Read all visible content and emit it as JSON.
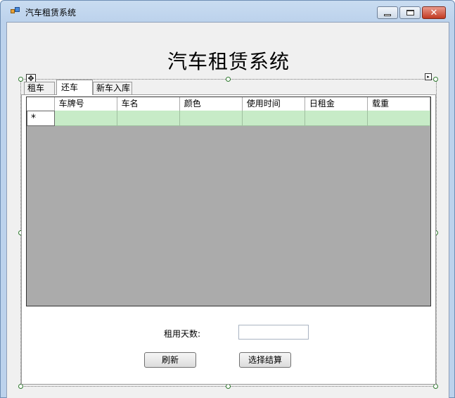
{
  "window": {
    "title": "汽车租赁系统",
    "icon": "app-icon",
    "controls": [
      "minimize-icon",
      "maximize-icon",
      "close-icon"
    ],
    "close_glyph": "✕"
  },
  "main": {
    "heading": "汽车租赁系统",
    "tabs": [
      {
        "label": "租车",
        "selected": false
      },
      {
        "label": "还车",
        "selected": true
      },
      {
        "label": "新车入库",
        "selected": false
      }
    ],
    "grid": {
      "columns": [
        "车牌号",
        "车名",
        "颜色",
        "使用时间",
        "日租金",
        "载重"
      ],
      "new_row_marker": "*",
      "rows": [
        [
          "",
          "",
          "",
          "",
          "",
          ""
        ]
      ],
      "colors": {
        "row_bg": "#c7ebc7",
        "grid_bg": "#ababab"
      }
    },
    "rental_days": {
      "label": "租用天数:",
      "value": ""
    },
    "buttons": {
      "refresh": "刷新",
      "settle": "选择结算"
    }
  },
  "designer": {
    "move_glyph": "✥",
    "smart_tag_glyph": "▸"
  }
}
